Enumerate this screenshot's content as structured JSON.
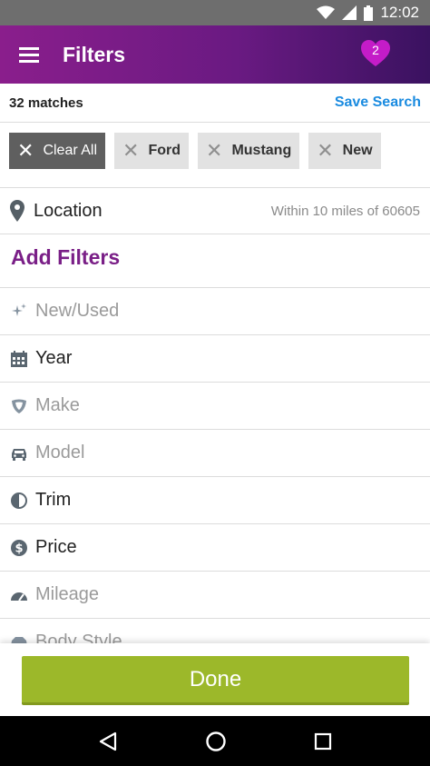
{
  "status_bar": {
    "time": "12:02"
  },
  "app_bar": {
    "title": "Filters",
    "favorites_count": "2"
  },
  "results": {
    "count_label": "32 matches",
    "save_search_label": "Save Search"
  },
  "chips": [
    {
      "label": "Clear All"
    },
    {
      "label": "Ford"
    },
    {
      "label": "Mustang"
    },
    {
      "label": "New"
    }
  ],
  "location": {
    "label": "Location",
    "value": "Within 10 miles of 60605"
  },
  "add_filters": {
    "title": "Add Filters"
  },
  "filters": [
    {
      "label": "New/Used",
      "icon": "sparkle-icon",
      "state": "muted"
    },
    {
      "label": "Year",
      "icon": "calendar-icon",
      "state": "active"
    },
    {
      "label": "Make",
      "icon": "badge-icon",
      "state": "muted"
    },
    {
      "label": "Model",
      "icon": "car-icon",
      "state": "muted"
    },
    {
      "label": "Trim",
      "icon": "half-circle-icon",
      "state": "active"
    },
    {
      "label": "Price",
      "icon": "dollar-icon",
      "state": "active"
    },
    {
      "label": "Mileage",
      "icon": "speedometer-icon",
      "state": "muted"
    },
    {
      "label": "Body Style",
      "icon": "car-body-icon",
      "state": "muted"
    }
  ],
  "done": {
    "label": "Done"
  },
  "colors": {
    "brand_purple": "#7a1f87",
    "accent_blue": "#1a8be0",
    "done_green": "#9cb82a",
    "heart": "#c41cc8"
  }
}
